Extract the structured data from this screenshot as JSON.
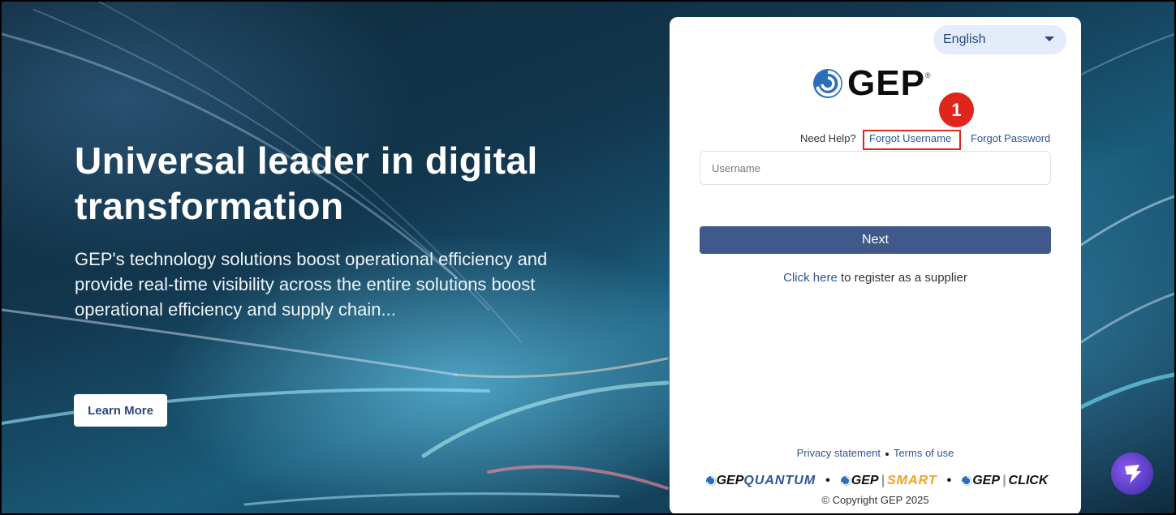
{
  "hero": {
    "title": "Universal leader in digital transformation",
    "description": "GEP's technology solutions boost operational efficiency and provide real-time visibility across the entire solutions boost operational efficiency and supply chain...",
    "learn_more": "Learn More"
  },
  "login": {
    "language": "English",
    "logo_text": "GEP",
    "annotation_number": "1",
    "need_help": "Need Help?",
    "forgot_username": "Forgot Username",
    "forgot_password": "Forgot Password",
    "username_placeholder": "Username",
    "next_label": "Next",
    "register_link": "Click here",
    "register_text": " to register as a supplier",
    "privacy": "Privacy statement",
    "terms": "Terms of use",
    "brands": {
      "quantum_prefix": "GEP",
      "quantum_name": "QUANTUM",
      "smart_prefix": "GEP",
      "smart_name": "SMART",
      "click_prefix": "GEP",
      "click_name": "CLICK",
      "separator": "•"
    },
    "copyright": "© Copyright GEP 2025"
  },
  "colors": {
    "accent": "#2c5596",
    "button": "#3f5a8a",
    "annotation": "#e0261b",
    "smart": "#f2a11f"
  }
}
